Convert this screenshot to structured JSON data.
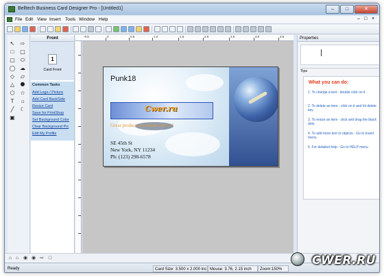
{
  "window": {
    "title": "Belltech Business Card Designer Pro - [Untitled1]",
    "controls": [
      "–",
      "□",
      "✕"
    ]
  },
  "menu": {
    "items": [
      "File",
      "Edit",
      "View",
      "Insert",
      "Tools",
      "Window",
      "Help"
    ],
    "mdi_controls": [
      "–",
      "□",
      "×"
    ]
  },
  "front_panel": {
    "header": "Front",
    "thumb_number": "1",
    "thumb_label": "Card Front"
  },
  "common_tasks": {
    "title": "Common Tasks",
    "links": [
      "Add Logo / Picture",
      "Add Card BackSide",
      "Resize Card",
      "Save for PrintShop",
      "Set Background Color",
      "Clear Background Pic",
      "Edit My Profile"
    ]
  },
  "ruler": {
    "h_labels": [
      "-0.5",
      "0",
      "0.5",
      "1.0",
      "1.5",
      "2.0",
      "2.5",
      "3.0",
      "3.5"
    ],
    "v_labels": [
      "",
      "",
      "",
      "",
      "",
      "",
      "",
      "",
      "",
      "",
      "",
      ""
    ]
  },
  "card": {
    "name": "Punk18",
    "banner": "Cwer.ru",
    "slogan": "Great product, awesome service!",
    "address1": "SE 45th St",
    "address2": "New York, NY 11234",
    "phone": "Ph: (123) 298-6578"
  },
  "properties": {
    "header": "Properties",
    "tips_header": "Tips",
    "tips_title": "What you can do:",
    "tips": [
      "1. To change a text - double click on it",
      "2. To delete an item - click on it and hit delete key",
      "3. To resize an item - click and drag the black dots",
      "4. To add more text or objects - Go to Insert menu",
      "5. For detailed help - Go to HELP menu"
    ]
  },
  "status": {
    "ready": "Ready",
    "card_size": "Card Size: 3.500 x 2.000 inc",
    "mouse": "Mouse: 3.76, 2.15 inch",
    "zoom": "Zoom:150%"
  },
  "watermark": "CWER.RU"
}
